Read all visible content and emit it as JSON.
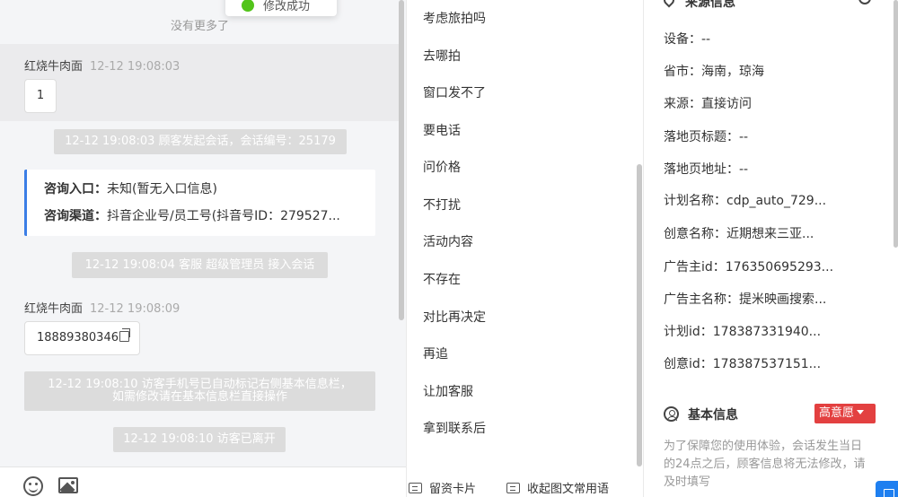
{
  "toast": {
    "text": "修改成功"
  },
  "chat": {
    "no_more": "没有更多了",
    "messages": [
      {
        "sender": "红烧牛肉面",
        "time": "12-12 19:08:03",
        "content": "1"
      },
      {
        "sender": "红烧牛肉面",
        "time": "12-12 19:08:09",
        "content": "18889380346"
      }
    ],
    "system": [
      "12-12 19:08:03 顾客发起会话，会话编号：25179",
      "12-12 19:08:04 客服 超级管理员 接入会话",
      "12-12 19:08:10 访客手机号已自动标记右侧基本信息栏，",
      "如需修改请在基本信息栏直接操作",
      "12-12 19:08:10 访客已离开"
    ],
    "card": {
      "entry_label": "咨询入口：",
      "entry_value": "未知(暂无入口信息)",
      "channel_label": "咨询渠道：",
      "channel_value": "抖音企业号/员工号(抖音号ID：279527..."
    }
  },
  "quick_replies": [
    "考虑旅拍吗",
    "去哪拍",
    "窗口发不了",
    "要电话",
    "问价格",
    "不打扰",
    "活动内容",
    "不存在",
    "对比再决定",
    "再追",
    "让加客服",
    "拿到联系后"
  ],
  "toolbar": {
    "card_button": "留资卡片",
    "collapse_button": "收起图文常用语"
  },
  "info": {
    "source_title": "来源信息",
    "rows": [
      "设备：--",
      "省市：海南，琼海",
      "来源：直接访问",
      "落地页标题：--",
      "落地页地址：--",
      "计划名称：cdp_auto_729...",
      "创意名称：近期想来三亚...",
      "广告主id：176350695293...",
      "广告主名称：提米映画搜索...",
      "计划id：178387331940...",
      "创意id：178387537151..."
    ],
    "basic_title": "基本信息",
    "intent_badge": "高意愿",
    "notice": "为了保障您的使用体验，会话发生当日的24点之后，顾客信息将无法修改，请及时填写",
    "colors": {
      "accent": "#3b7ee6",
      "badge": "#e34040",
      "float": "#1e7ff0"
    }
  }
}
